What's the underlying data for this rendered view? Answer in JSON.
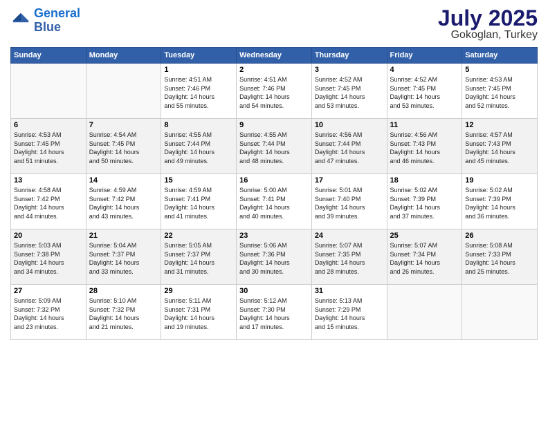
{
  "header": {
    "logo_line1": "General",
    "logo_line2": "Blue",
    "main_title": "July 2025",
    "subtitle": "Gokoglan, Turkey"
  },
  "calendar": {
    "days_of_week": [
      "Sunday",
      "Monday",
      "Tuesday",
      "Wednesday",
      "Thursday",
      "Friday",
      "Saturday"
    ],
    "rows": [
      [
        {
          "day": "",
          "info": ""
        },
        {
          "day": "",
          "info": ""
        },
        {
          "day": "1",
          "info": "Sunrise: 4:51 AM\nSunset: 7:46 PM\nDaylight: 14 hours\nand 55 minutes."
        },
        {
          "day": "2",
          "info": "Sunrise: 4:51 AM\nSunset: 7:46 PM\nDaylight: 14 hours\nand 54 minutes."
        },
        {
          "day": "3",
          "info": "Sunrise: 4:52 AM\nSunset: 7:45 PM\nDaylight: 14 hours\nand 53 minutes."
        },
        {
          "day": "4",
          "info": "Sunrise: 4:52 AM\nSunset: 7:45 PM\nDaylight: 14 hours\nand 53 minutes."
        },
        {
          "day": "5",
          "info": "Sunrise: 4:53 AM\nSunset: 7:45 PM\nDaylight: 14 hours\nand 52 minutes."
        }
      ],
      [
        {
          "day": "6",
          "info": "Sunrise: 4:53 AM\nSunset: 7:45 PM\nDaylight: 14 hours\nand 51 minutes."
        },
        {
          "day": "7",
          "info": "Sunrise: 4:54 AM\nSunset: 7:45 PM\nDaylight: 14 hours\nand 50 minutes."
        },
        {
          "day": "8",
          "info": "Sunrise: 4:55 AM\nSunset: 7:44 PM\nDaylight: 14 hours\nand 49 minutes."
        },
        {
          "day": "9",
          "info": "Sunrise: 4:55 AM\nSunset: 7:44 PM\nDaylight: 14 hours\nand 48 minutes."
        },
        {
          "day": "10",
          "info": "Sunrise: 4:56 AM\nSunset: 7:44 PM\nDaylight: 14 hours\nand 47 minutes."
        },
        {
          "day": "11",
          "info": "Sunrise: 4:56 AM\nSunset: 7:43 PM\nDaylight: 14 hours\nand 46 minutes."
        },
        {
          "day": "12",
          "info": "Sunrise: 4:57 AM\nSunset: 7:43 PM\nDaylight: 14 hours\nand 45 minutes."
        }
      ],
      [
        {
          "day": "13",
          "info": "Sunrise: 4:58 AM\nSunset: 7:42 PM\nDaylight: 14 hours\nand 44 minutes."
        },
        {
          "day": "14",
          "info": "Sunrise: 4:59 AM\nSunset: 7:42 PM\nDaylight: 14 hours\nand 43 minutes."
        },
        {
          "day": "15",
          "info": "Sunrise: 4:59 AM\nSunset: 7:41 PM\nDaylight: 14 hours\nand 41 minutes."
        },
        {
          "day": "16",
          "info": "Sunrise: 5:00 AM\nSunset: 7:41 PM\nDaylight: 14 hours\nand 40 minutes."
        },
        {
          "day": "17",
          "info": "Sunrise: 5:01 AM\nSunset: 7:40 PM\nDaylight: 14 hours\nand 39 minutes."
        },
        {
          "day": "18",
          "info": "Sunrise: 5:02 AM\nSunset: 7:39 PM\nDaylight: 14 hours\nand 37 minutes."
        },
        {
          "day": "19",
          "info": "Sunrise: 5:02 AM\nSunset: 7:39 PM\nDaylight: 14 hours\nand 36 minutes."
        }
      ],
      [
        {
          "day": "20",
          "info": "Sunrise: 5:03 AM\nSunset: 7:38 PM\nDaylight: 14 hours\nand 34 minutes."
        },
        {
          "day": "21",
          "info": "Sunrise: 5:04 AM\nSunset: 7:37 PM\nDaylight: 14 hours\nand 33 minutes."
        },
        {
          "day": "22",
          "info": "Sunrise: 5:05 AM\nSunset: 7:37 PM\nDaylight: 14 hours\nand 31 minutes."
        },
        {
          "day": "23",
          "info": "Sunrise: 5:06 AM\nSunset: 7:36 PM\nDaylight: 14 hours\nand 30 minutes."
        },
        {
          "day": "24",
          "info": "Sunrise: 5:07 AM\nSunset: 7:35 PM\nDaylight: 14 hours\nand 28 minutes."
        },
        {
          "day": "25",
          "info": "Sunrise: 5:07 AM\nSunset: 7:34 PM\nDaylight: 14 hours\nand 26 minutes."
        },
        {
          "day": "26",
          "info": "Sunrise: 5:08 AM\nSunset: 7:33 PM\nDaylight: 14 hours\nand 25 minutes."
        }
      ],
      [
        {
          "day": "27",
          "info": "Sunrise: 5:09 AM\nSunset: 7:32 PM\nDaylight: 14 hours\nand 23 minutes."
        },
        {
          "day": "28",
          "info": "Sunrise: 5:10 AM\nSunset: 7:32 PM\nDaylight: 14 hours\nand 21 minutes."
        },
        {
          "day": "29",
          "info": "Sunrise: 5:11 AM\nSunset: 7:31 PM\nDaylight: 14 hours\nand 19 minutes."
        },
        {
          "day": "30",
          "info": "Sunrise: 5:12 AM\nSunset: 7:30 PM\nDaylight: 14 hours\nand 17 minutes."
        },
        {
          "day": "31",
          "info": "Sunrise: 5:13 AM\nSunset: 7:29 PM\nDaylight: 14 hours\nand 15 minutes."
        },
        {
          "day": "",
          "info": ""
        },
        {
          "day": "",
          "info": ""
        }
      ]
    ]
  }
}
